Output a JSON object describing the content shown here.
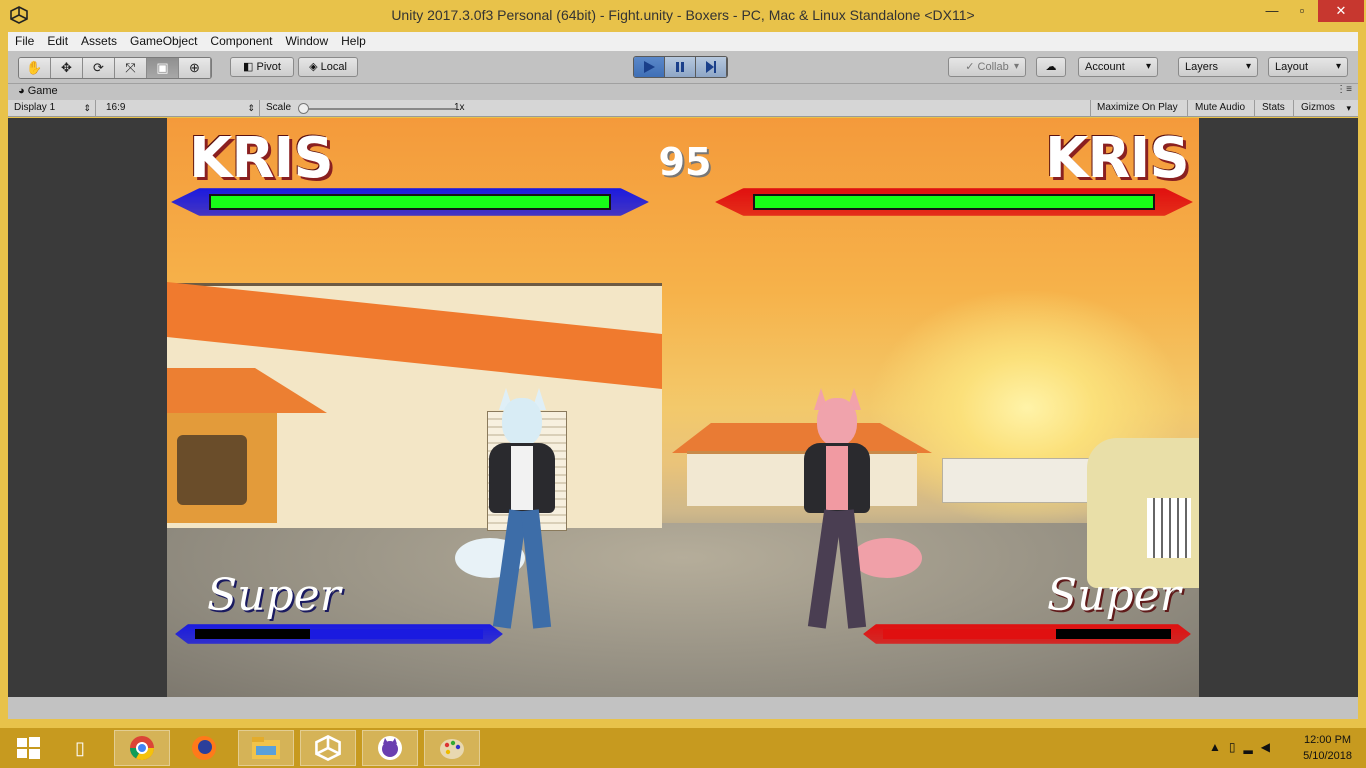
{
  "window": {
    "title": "Unity 2017.3.0f3 Personal (64bit) - Fight.unity - Boxers - PC, Mac & Linux Standalone <DX11>"
  },
  "menu": [
    "File",
    "Edit",
    "Assets",
    "GameObject",
    "Component",
    "Window",
    "Help"
  ],
  "toolbar": {
    "tools": [
      "hand-tool-icon",
      "move-tool-icon",
      "rotate-tool-icon",
      "scale-tool-icon",
      "rect-tool-icon",
      "transform-tool-icon"
    ],
    "pivot_label": "Pivot",
    "local_label": "Local",
    "collab_label": "Collab",
    "account_label": "Account",
    "layers_label": "Layers",
    "layout_label": "Layout"
  },
  "game_view": {
    "tab_label": "Game",
    "display": "Display 1",
    "aspect": "16:9",
    "scale_label": "Scale",
    "scale_value": "1x",
    "scale_fraction": 0.0,
    "maximize_label": "Maximize On Play",
    "mute_label": "Mute Audio",
    "stats_label": "Stats",
    "gizmos_label": "Gizmos"
  },
  "hud": {
    "p1_name": "KRIS",
    "p2_name": "KRIS",
    "timer": "95",
    "p1_health": 1.0,
    "p2_health": 1.0,
    "p1_super_label": "Super",
    "p2_super_label": "Super",
    "p1_super": 0.6,
    "p2_super": 0.6,
    "p1_color": "#1a1ae0",
    "p2_color": "#e01010",
    "health_color": "#18ff18"
  },
  "taskbar": {
    "apps": [
      "windows-start-icon",
      "file-icon",
      "chrome-icon",
      "firefox-icon",
      "file-explorer-icon",
      "unity-icon",
      "app-purple-icon",
      "paint-icon"
    ],
    "time": "12:00 PM",
    "date": "5/10/2018"
  }
}
